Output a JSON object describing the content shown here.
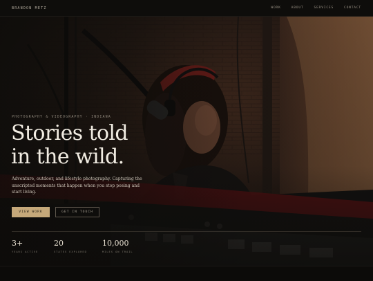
{
  "nav": {
    "brand": "BRANDON METZ",
    "links": [
      "WORK",
      "ABOUT",
      "SERVICES",
      "CONTACT"
    ]
  },
  "hero": {
    "eyebrow": "PHOTOGRAPHY & VIDEOGRAPHY · INDIANA",
    "title_line1": "Stories told",
    "title_line2": "in the wild.",
    "description": "Adventure, outdoor, and lifestyle photography. Capturing the unscripted moments that happen when you stop posing and start living.",
    "primary_button": "VIEW WORK",
    "secondary_button": "GET IN TOUCH"
  },
  "stats": [
    {
      "value": "3+",
      "label": "YEARS ACTIVE"
    },
    {
      "value": "20",
      "label": "STATES EXPLORED"
    },
    {
      "value": "10,000",
      "label": "MILES ON TRAIL"
    }
  ],
  "colors": {
    "accent": "#c5a87a",
    "background": "#0d0c0a",
    "text": "#f1ece2"
  }
}
